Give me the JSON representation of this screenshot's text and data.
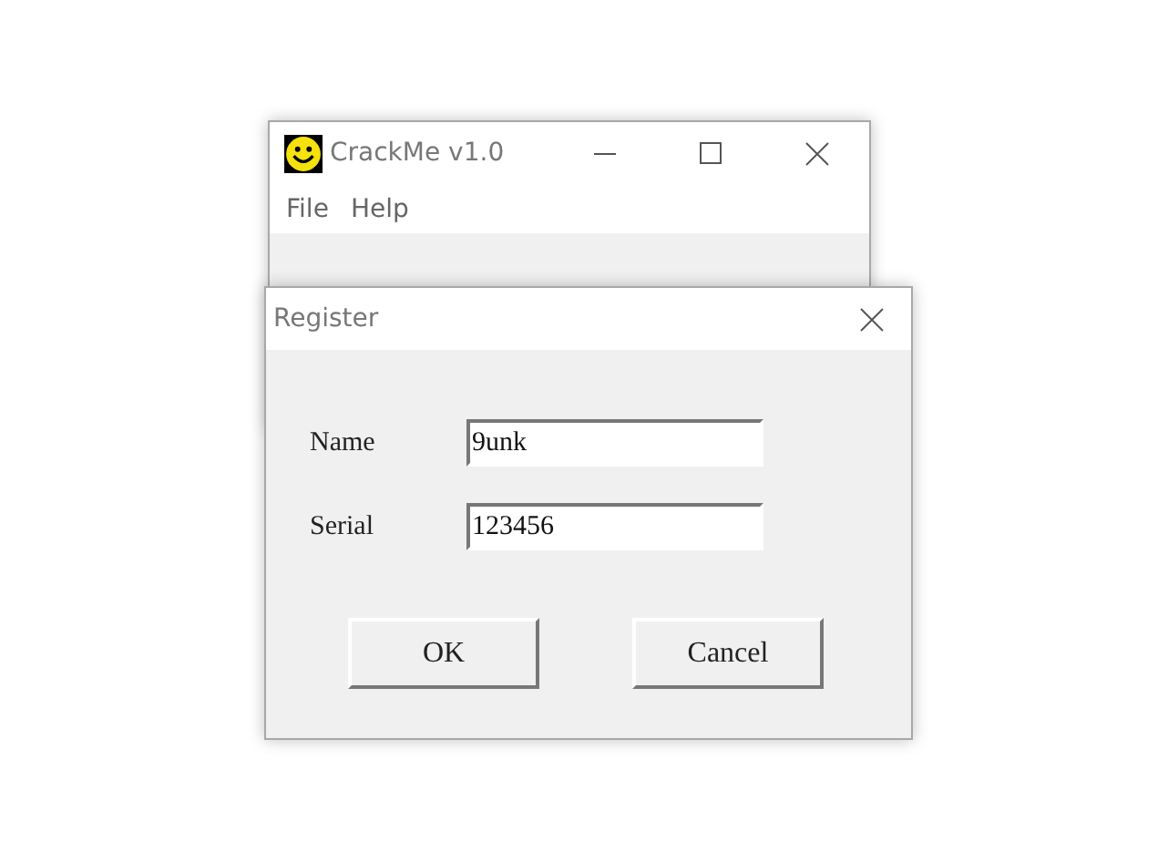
{
  "main_window": {
    "title": "CrackMe v1.0",
    "menu": [
      "File",
      "Help"
    ]
  },
  "dialog": {
    "title": "Register",
    "fields": [
      {
        "label": "Name",
        "value": "9unk"
      },
      {
        "label": "Serial",
        "value": "123456"
      }
    ],
    "buttons": [
      "OK",
      "Cancel"
    ]
  }
}
